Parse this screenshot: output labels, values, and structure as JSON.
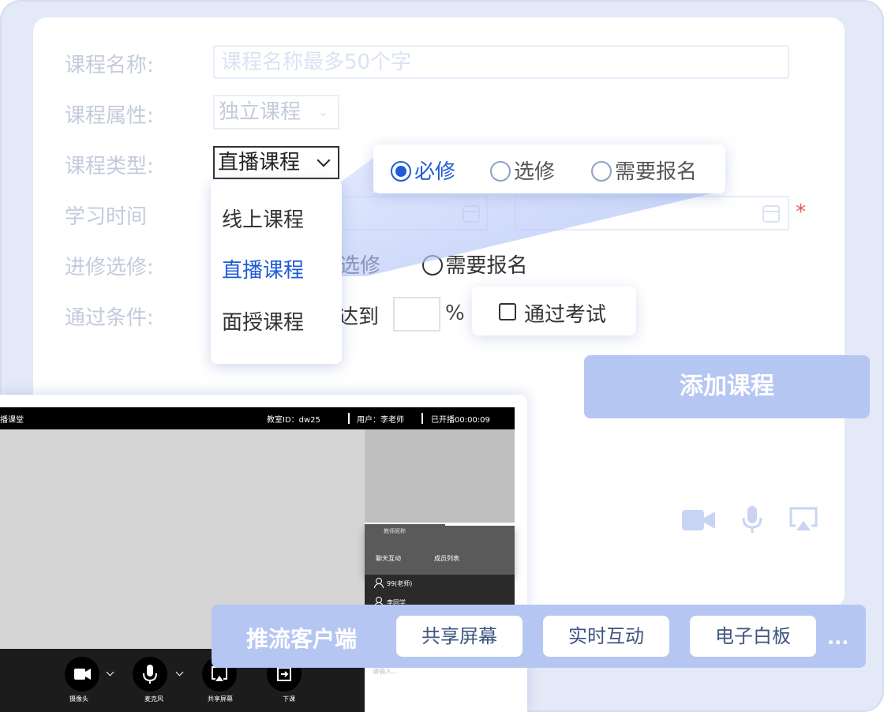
{
  "form": {
    "labels": {
      "name": "课程名称:",
      "attribute": "课程属性:",
      "type": "课程类型:",
      "time": "学习时间",
      "elective": "进修选修:",
      "condition": "通过条件:"
    },
    "name_placeholder": "课程名称最多50个字",
    "attribute_value": "独立课程",
    "type_value": "直播课程",
    "elective_options": [
      "选修",
      "需要报名"
    ],
    "condition_text": "达到",
    "percent_sign": "%",
    "exam_label": "通过考试",
    "required_mark": "*"
  },
  "type_dropdown": {
    "options": [
      "线上课程",
      "直播课程",
      "面授课程"
    ],
    "selected_index": 1
  },
  "radio_popup": {
    "options": [
      "必修",
      "选修",
      "需要报名"
    ],
    "selected_index": 0
  },
  "add_button_label": "添加课程",
  "live_room": {
    "title": "播课堂",
    "classroom_id": "教室ID：dw25",
    "user": "用户：李老师",
    "elapsed": "已开播00:00:09",
    "teacher_caption": "教师昵称",
    "tabs": [
      "聊天互动",
      "成员列表"
    ],
    "members": [
      "99(老师)",
      "李同学"
    ],
    "input_hint": "请输入...",
    "controls": [
      "摄像头",
      "麦克风",
      "共享屏幕",
      "下课"
    ]
  },
  "push_client": {
    "title": "推流客户端",
    "features": [
      "共享屏幕",
      "实时互动",
      "电子白板"
    ],
    "more": "..."
  },
  "colors": {
    "accent": "#1f5bd6",
    "bar": "#b6c6f3",
    "frame": "#e4e9f8",
    "required": "#e15a5a"
  }
}
